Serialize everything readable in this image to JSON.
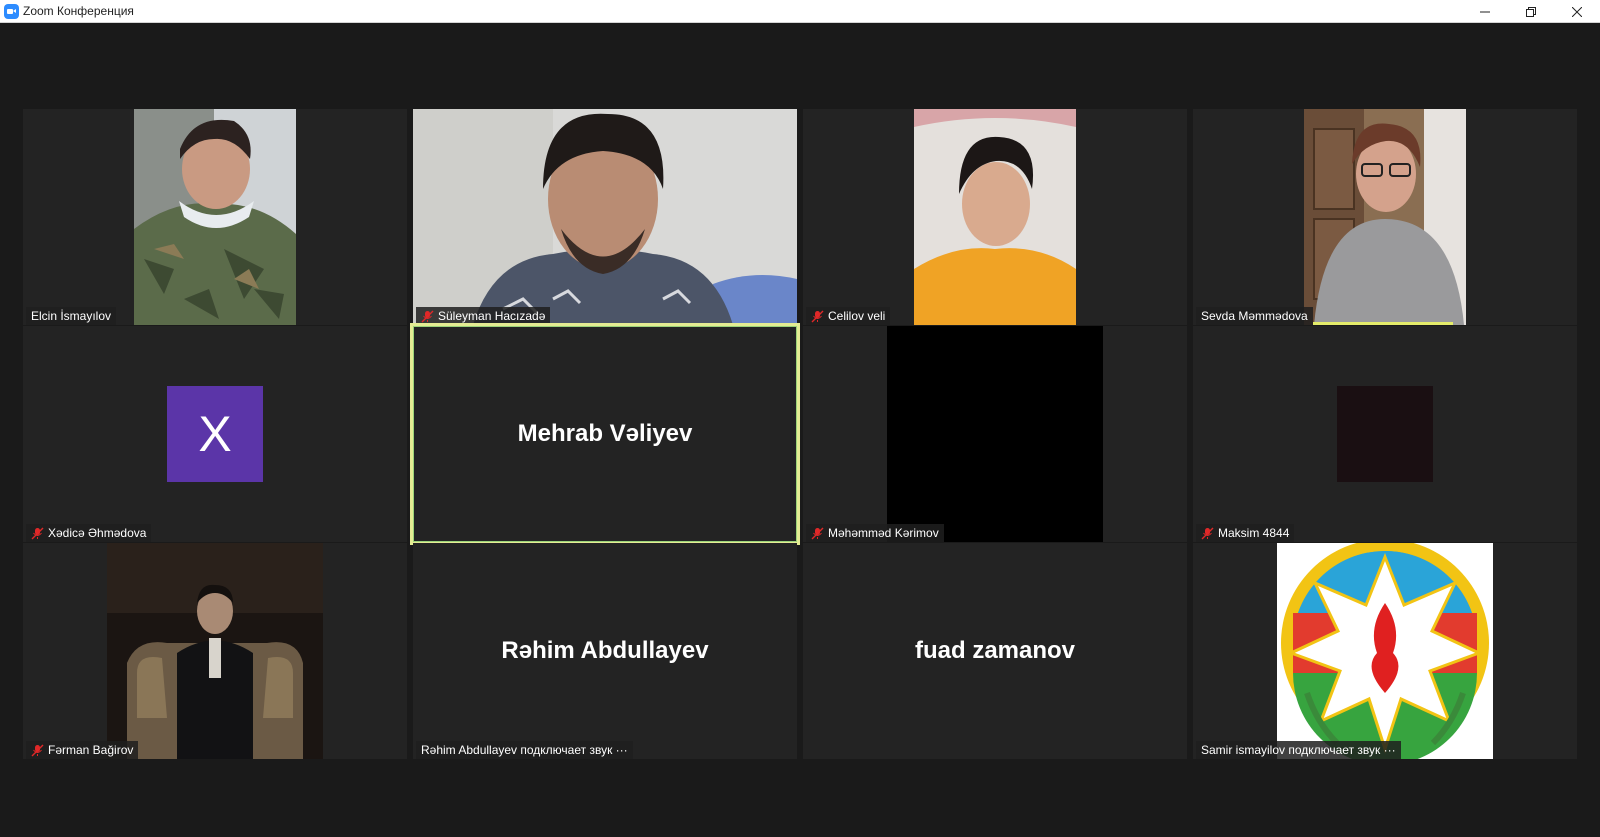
{
  "window": {
    "title": "Zoom Конференция",
    "controls": [
      "minimize-icon",
      "restore-icon",
      "close-icon"
    ]
  },
  "colors": {
    "active_speaker_border": "#e4ec93",
    "muted_icon": "#e02828",
    "tile_bg": "#232323",
    "avatar_purple": "#5b35a8"
  },
  "participants": [
    {
      "name": "Elcin İsmayılov",
      "muted": false,
      "video": "soldier-camo"
    },
    {
      "name": "Süleyman Hacızadə",
      "muted": true,
      "video": "young-man"
    },
    {
      "name": "Celilov veli",
      "muted": true,
      "video": "boy-orange"
    },
    {
      "name": "Sevda Məmmədova",
      "muted": false,
      "video": "woman-glasses"
    },
    {
      "name": "Xədicə Əhmədova",
      "muted": true,
      "avatar_letter": "X"
    },
    {
      "name": "Mehrab Vəliyev",
      "center_name": "Mehrab Vəliyev",
      "active": true
    },
    {
      "name": "Məhəmməd Kərimov",
      "muted": true,
      "video": "black"
    },
    {
      "name": "Maksim 4844",
      "muted": true,
      "video": "dark-avatar"
    },
    {
      "name": "Fərman Bağirov",
      "muted": true,
      "video": "man-chair"
    },
    {
      "center_name": "Rəhim Abdullayev",
      "label": "Rəhim Abdullayev подключает звук ···"
    },
    {
      "center_name": "fuad zamanov"
    },
    {
      "label": "Samir ismayilov подключает звук ···",
      "video": "azerbaijan-emblem"
    }
  ]
}
